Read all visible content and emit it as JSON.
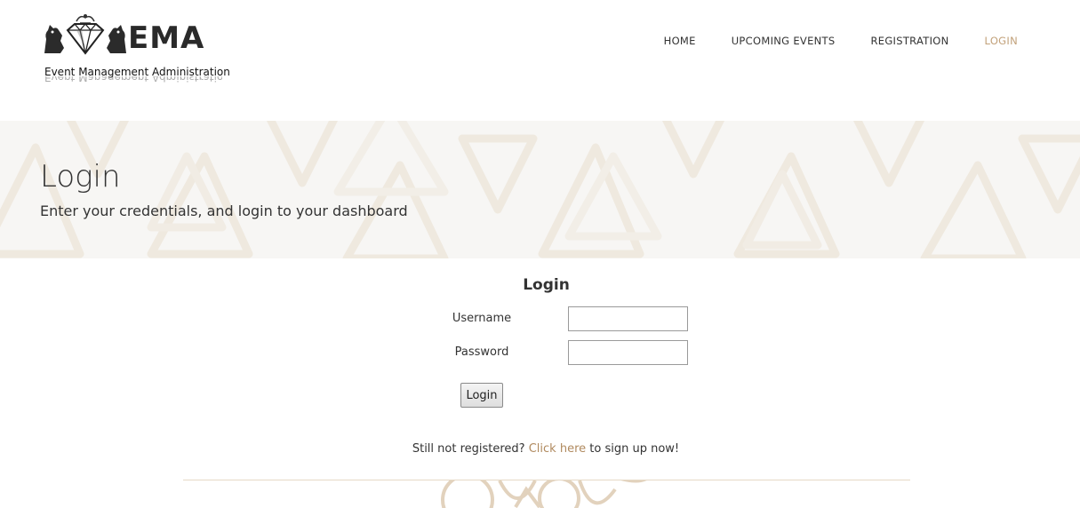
{
  "header": {
    "logo_word": "EMA",
    "logo_tagline": "Event Management Administration",
    "nav": [
      {
        "label": "HOME",
        "active": false
      },
      {
        "label": "UPCOMING EVENTS",
        "active": false
      },
      {
        "label": "REGISTRATION",
        "active": false
      },
      {
        "label": "LOGIN",
        "active": true
      }
    ],
    "accent_color": "#c2a17a"
  },
  "banner": {
    "title": "Login",
    "subtitle": "Enter your credentials, and login to your dashboard",
    "background_color": "#f7f6f4"
  },
  "login_form": {
    "title": "Login",
    "username_label": "Username",
    "username_value": "",
    "password_label": "Password",
    "password_value": "",
    "submit_label": "Login"
  },
  "signup": {
    "prefix": "Still not registered?",
    "link_text": "Click here",
    "suffix": "to sign up now!",
    "link_color": "#b08a5f"
  },
  "icons": {
    "logo_mark": "diamond-lions-crest-icon",
    "footer_ornament": "rings-ornament-icon"
  }
}
